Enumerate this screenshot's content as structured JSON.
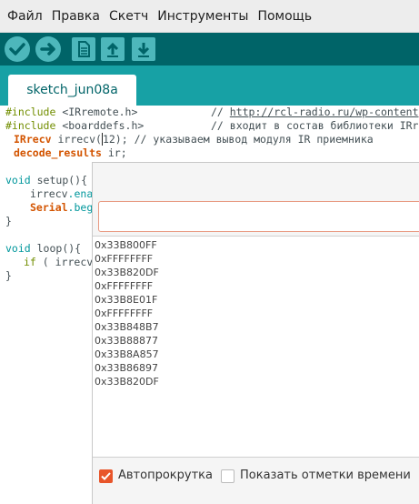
{
  "menu": [
    "Файл",
    "Правка",
    "Скетч",
    "Инструменты",
    "Помощь"
  ],
  "toolbar": {
    "verify_icon": "checkmark-icon",
    "upload_icon": "arrow-right-icon",
    "new_icon": "document-icon",
    "open_icon": "arrow-up-icon",
    "save_icon": "arrow-down-icon"
  },
  "tab": {
    "name": "sketch_jun08a"
  },
  "code": {
    "l1_kw": "#include",
    "l1_rest": " <IRremote.h>",
    "l1_comment": "// ",
    "l1_url": "http://rcl-radio.ru/wp-content",
    "l2_kw": "#include",
    "l2_rest": " <boarddefs.h>",
    "l2_comment": "// входит в состав библиотеки IRr",
    "l3_type": "IRrecv",
    "l3_rest": " irrecv(",
    "l3_cursor": "1",
    "l3_rest2": "2); ",
    "l3_comment": "// указываем вывод модуля IR приемника",
    "l4_type": "decode_results",
    "l4_rest": " ir;",
    "l6_kw": "void",
    "l6_rest": " setup(){",
    "l7_obj": "irrecv",
    "l7_rest": ".ena",
    "l8_obj": "Serial",
    "l8_rest": ".beg",
    "l9": "}",
    "l11_kw": "void",
    "l11_rest": " loop(){",
    "l12_kw": "if",
    "l12_rest": " ( irrecv",
    "l13": "}"
  },
  "monitor": {
    "input_value": "",
    "output": [
      "0x33B800FF",
      "0xFFFFFFFF",
      "0x33B820DF",
      "0xFFFFFFFF",
      "0x33B8E01F",
      "0xFFFFFFFF",
      "0x33B848B7",
      "0x33B88877",
      "0x33B8A857",
      "0x33B86897",
      "0x33B820DF"
    ],
    "autoscroll_label": "Автопрокрутка",
    "timestamp_label": "Показать отметки времени",
    "autoscroll_checked": true,
    "timestamp_checked": false
  },
  "colors": {
    "toolbar_bg": "#006468",
    "button_bg": "#4db7bb",
    "tabbar_bg": "#17a1a5",
    "checkbox_checked": "#e8552a"
  }
}
